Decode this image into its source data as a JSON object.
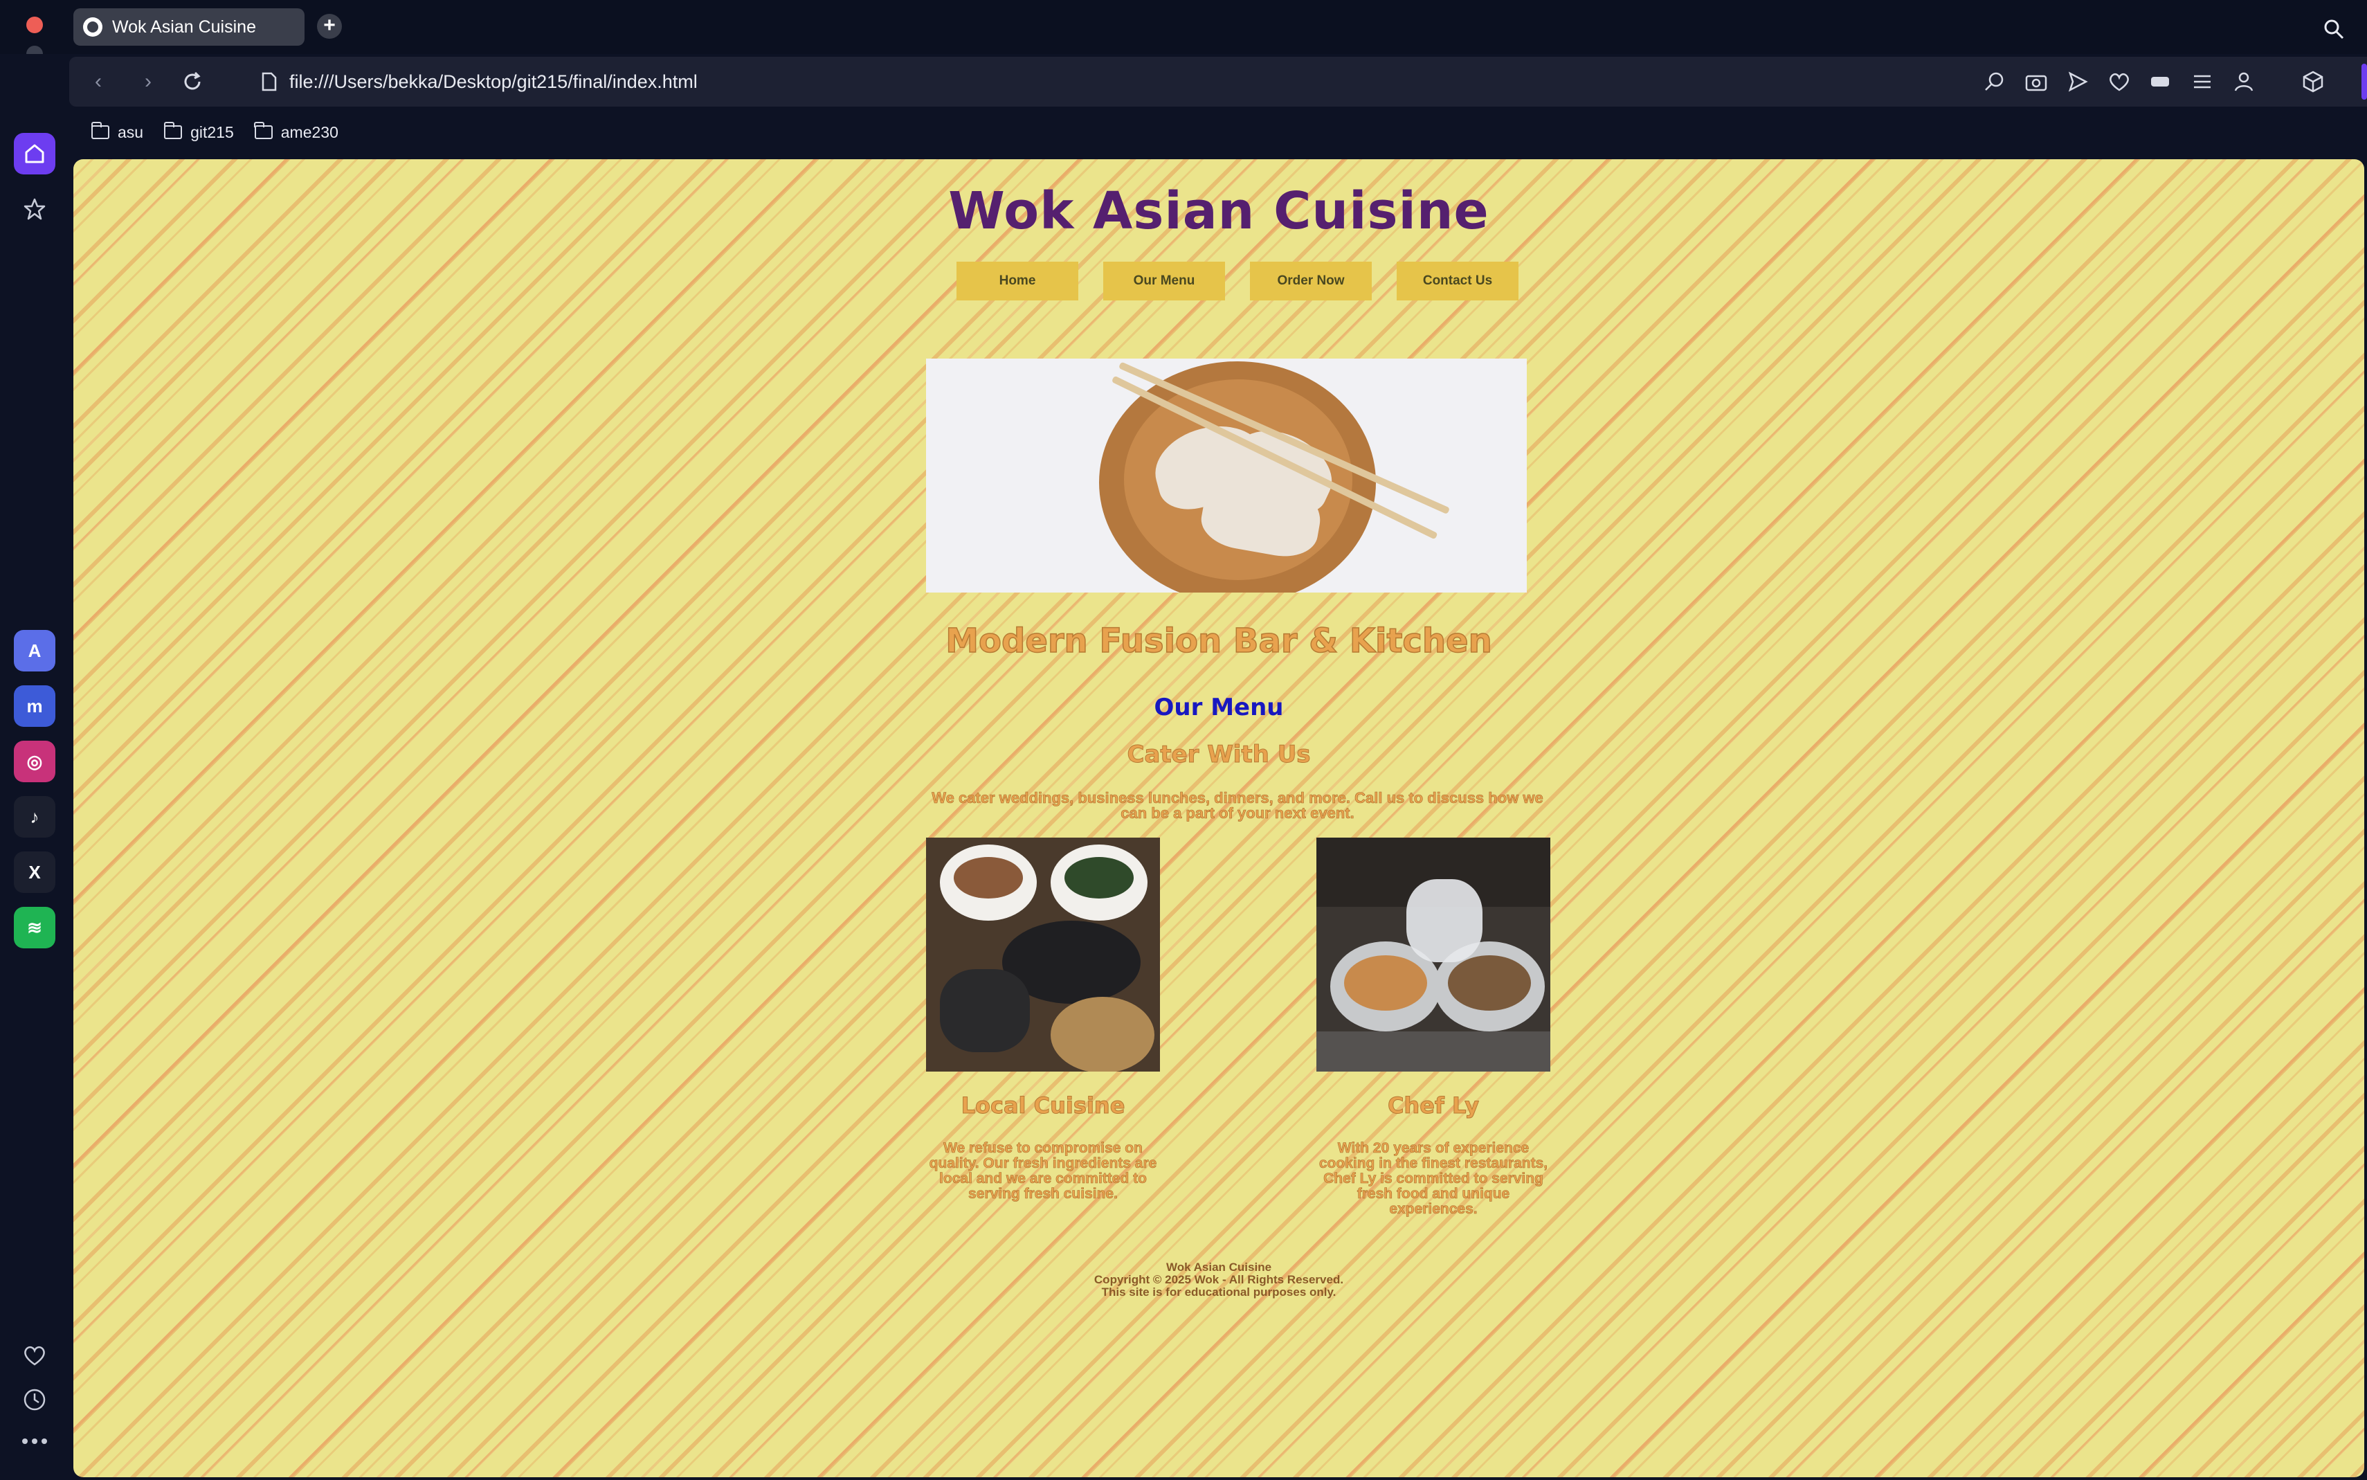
{
  "browser": {
    "tab_title": "Wok Asian Cuisine",
    "new_tab_label": "+",
    "url": "file:///Users/bekka/Desktop/git215/final/index.html",
    "bookmarks": [
      {
        "label": "asu"
      },
      {
        "label": "git215"
      },
      {
        "label": "ame230"
      }
    ],
    "accent_color": "#6d3df0"
  },
  "sidebar": {
    "apps": [
      {
        "name": "testflight-icon",
        "glyph": "A"
      },
      {
        "name": "messenger-icon",
        "glyph": "m"
      },
      {
        "name": "instagram-icon",
        "glyph": "◎"
      },
      {
        "name": "tiktok-icon",
        "glyph": "♪"
      },
      {
        "name": "x-icon",
        "glyph": "X"
      },
      {
        "name": "spotify-icon",
        "glyph": "≋"
      }
    ]
  },
  "site": {
    "title": "Wok Asian Cuisine",
    "nav": [
      "Home",
      "Our Menu",
      "Order Now",
      "Contact Us"
    ],
    "tagline": "Modern Fusion Bar & Kitchen",
    "menu_link": "Our Menu",
    "cater_heading": "Cater With Us",
    "cater_text": "We cater weddings, business lunches, dinners, and more. Call us to discuss how we can be a part of your next event.",
    "cards": [
      {
        "title": "Local Cuisine",
        "text": "We refuse to compromise on quality. Our fresh ingredients are local and we are committed to serving fresh cuisine."
      },
      {
        "title": "Chef Ly",
        "text": "With 20 years of experience cooking in the finest restaurants, Chef Ly is committed to serving fresh food and unique experiences."
      }
    ],
    "footer": {
      "line1": "Wok Asian Cuisine",
      "line2": "Copyright © 2025 Wok - All Rights Reserved.",
      "line3": "This site is for educational purposes only."
    },
    "colors": {
      "background": "#ebe48c",
      "title": "#55206f",
      "nav_button": "#e6c44a",
      "accent_text": "#e8a24e",
      "link": "#1818c0"
    }
  }
}
